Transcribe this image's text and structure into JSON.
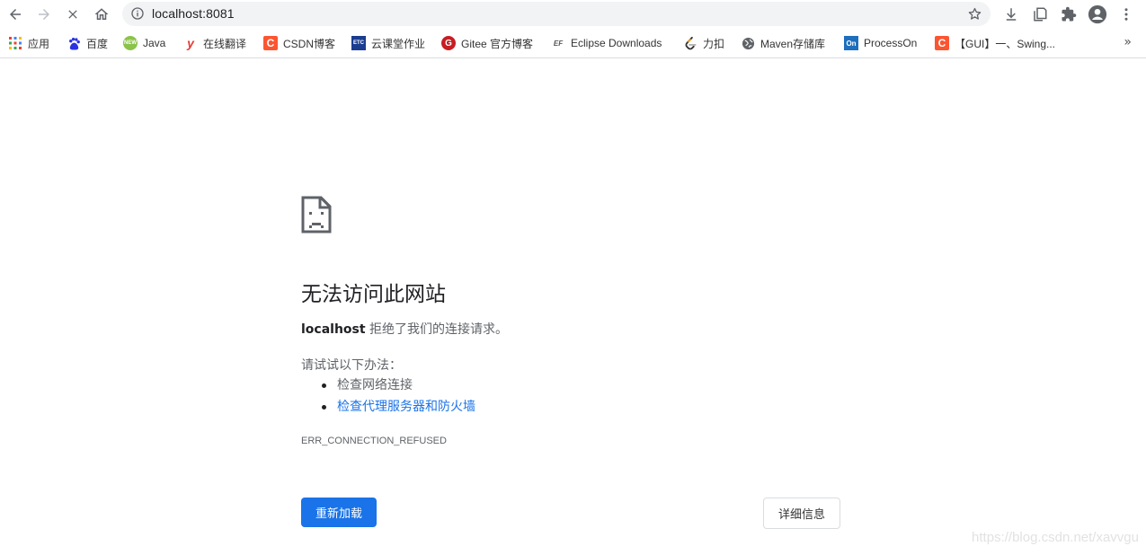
{
  "toolbar": {
    "url": "localhost:8081"
  },
  "bookmarks": [
    {
      "label": "应用",
      "icon": "apps-grid-icon",
      "color": "#4285f4"
    },
    {
      "label": "百度",
      "icon": "baidu-paw-icon",
      "color": "#2932e1"
    },
    {
      "label": "Java",
      "icon": "java-site-icon",
      "color": "#8bc34a"
    },
    {
      "label": "在线翻译",
      "icon": "youdao-icon",
      "color": "#e53935"
    },
    {
      "label": "CSDN博客",
      "icon": "csdn-icon",
      "color": "#fc5531"
    },
    {
      "label": "云课堂作业",
      "icon": "etc-icon",
      "color": "#1a3d8f"
    },
    {
      "label": "Gitee 官方博客",
      "icon": "gitee-icon",
      "color": "#c71d23"
    },
    {
      "label": "Eclipse Downloads",
      "icon": "eclipse-icon",
      "color": "#f7941e"
    },
    {
      "label": "力扣",
      "icon": "leetcode-icon",
      "color": "#333333"
    },
    {
      "label": "Maven存储库",
      "icon": "globe-icon",
      "color": "#5f6368"
    },
    {
      "label": "ProcessOn",
      "icon": "processon-icon",
      "color": "#1e6fbd"
    },
    {
      "label": "【GUI】一、Swing...",
      "icon": "csdn-icon",
      "color": "#fc5531"
    }
  ],
  "error": {
    "title": "无法访问此网站",
    "host": "localhost",
    "message": " 拒绝了我们的连接请求。",
    "try_heading": "请试试以下办法：",
    "suggestions": [
      {
        "text": "检查网络连接",
        "link": false
      },
      {
        "text": "检查代理服务器和防火墙",
        "link": true
      }
    ],
    "code": "ERR_CONNECTION_REFUSED",
    "reload_label": "重新加载",
    "details_label": "详细信息"
  },
  "watermark": "https://blog.csdn.net/xavvgu"
}
